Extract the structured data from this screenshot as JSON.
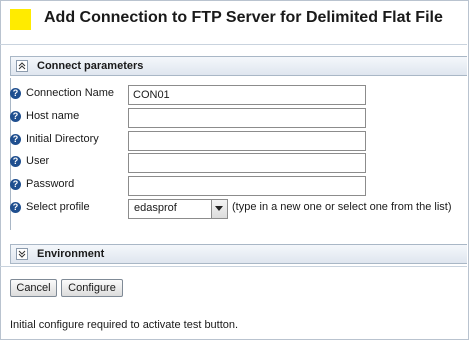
{
  "header": {
    "title": "Add Connection to FTP Server for Delimited Flat File"
  },
  "sections": {
    "connect": {
      "title": "Connect parameters"
    },
    "environment": {
      "title": "Environment"
    }
  },
  "form": {
    "connection_name": {
      "label": "Connection Name",
      "value": "CON01"
    },
    "host_name": {
      "label": "Host name",
      "value": ""
    },
    "initial_directory": {
      "label": "Initial Directory",
      "value": ""
    },
    "user": {
      "label": "User",
      "value": ""
    },
    "password": {
      "label": "Password",
      "value": ""
    },
    "select_profile": {
      "label": "Select profile",
      "value": "edasprof",
      "hint": "(type in a new one or select one from the list)"
    }
  },
  "buttons": {
    "cancel": "Cancel",
    "configure": "Configure"
  },
  "status": "Initial configure required to activate test button.",
  "icons": {
    "help": "?",
    "collapse": "chevron-up-double-icon",
    "expand": "chevron-down-double-icon"
  },
  "colors": {
    "title_marker": "#ffeb00",
    "help_icon": "#1f4f8f"
  }
}
